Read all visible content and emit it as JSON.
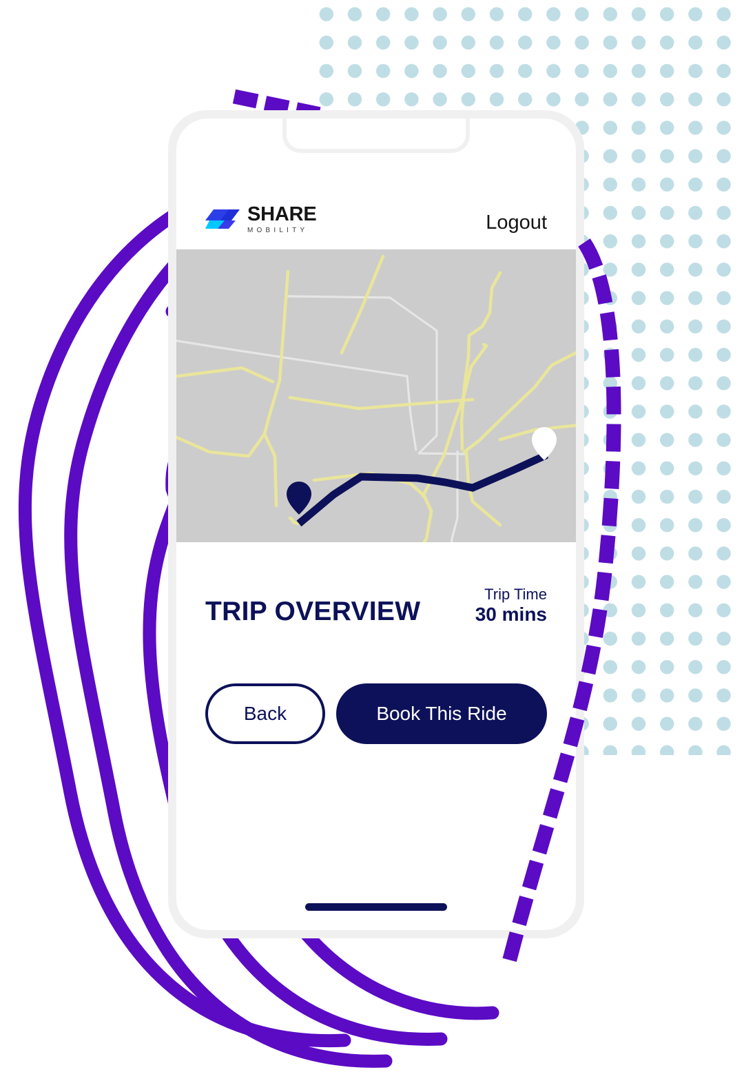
{
  "app": {
    "brand": {
      "name": "SHARE",
      "sub": "MOBILITY",
      "mark_colors": [
        "#1f3fe0",
        "#00c2ff",
        "#2b5bf0"
      ]
    },
    "header": {
      "logout_label": "Logout"
    },
    "trip": {
      "title": "TRIP OVERVIEW",
      "time_label": "Trip Time",
      "time_value": "30 mins"
    },
    "actions": {
      "back_label": "Back",
      "book_label": "Book This Ride"
    },
    "map": {
      "background_color": "#cccccc",
      "route_color": "#0d1159",
      "minor_road_color": "#ebe7a0",
      "major_road_color": "#e8e8e8",
      "origin_pin": "origin-pin-navy",
      "destination_pin": "destination-pin-white"
    }
  },
  "decoration": {
    "dot_color": "#bfdde4",
    "swirl_color": "#5b0bc4",
    "frame_color": "#f0f0f0",
    "navy": "#0d1159"
  }
}
